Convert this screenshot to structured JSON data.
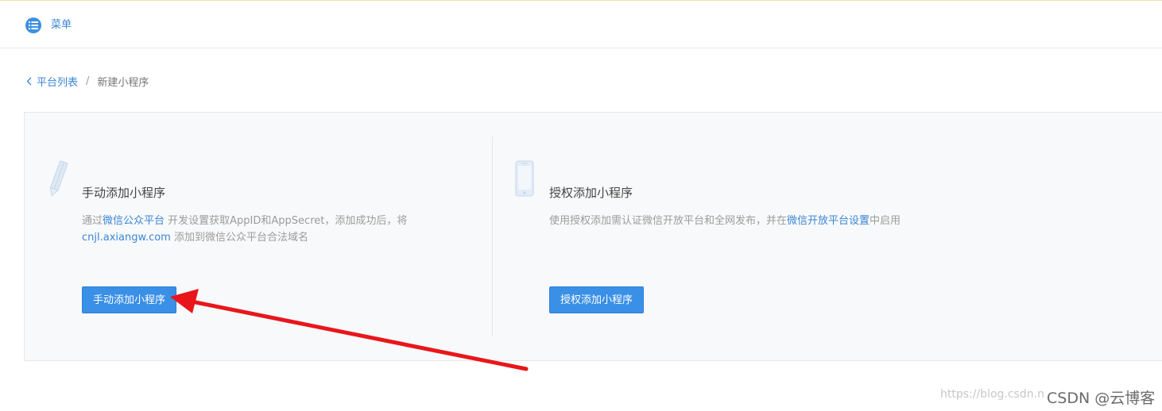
{
  "topbar": {
    "menu_label": "菜单",
    "menu_icon": "list-icon"
  },
  "breadcrumb": {
    "back_label": "平台列表",
    "separator": "/",
    "current": "新建小程序"
  },
  "cards": {
    "manual": {
      "icon": "pencil-icon",
      "title": "手动添加小程序",
      "desc_prefix": "通过",
      "desc_link": "微信公众平台",
      "desc_middle": " 开发设置获取AppID和AppSecret，添加成功后，将",
      "desc_domain": "cnjl.axiangw.com",
      "desc_suffix": " 添加到微信公众平台合法域名",
      "button_label": "手动添加小程序"
    },
    "authorize": {
      "icon": "phone-icon",
      "title": "授权添加小程序",
      "desc_prefix": "使用授权添加需认证微信开放平台和全网发布，并在",
      "desc_link": "微信开放平台设置",
      "desc_suffix": "中启用",
      "button_label": "授权添加小程序"
    }
  },
  "annotation": {
    "arrow_color": "#e8161b"
  },
  "watermark": {
    "url_text": "https://blog.csdn.n",
    "brand_text": "CSDN @云博客"
  },
  "colors": {
    "accent": "#3a8fe6",
    "link": "#3a86d6"
  }
}
